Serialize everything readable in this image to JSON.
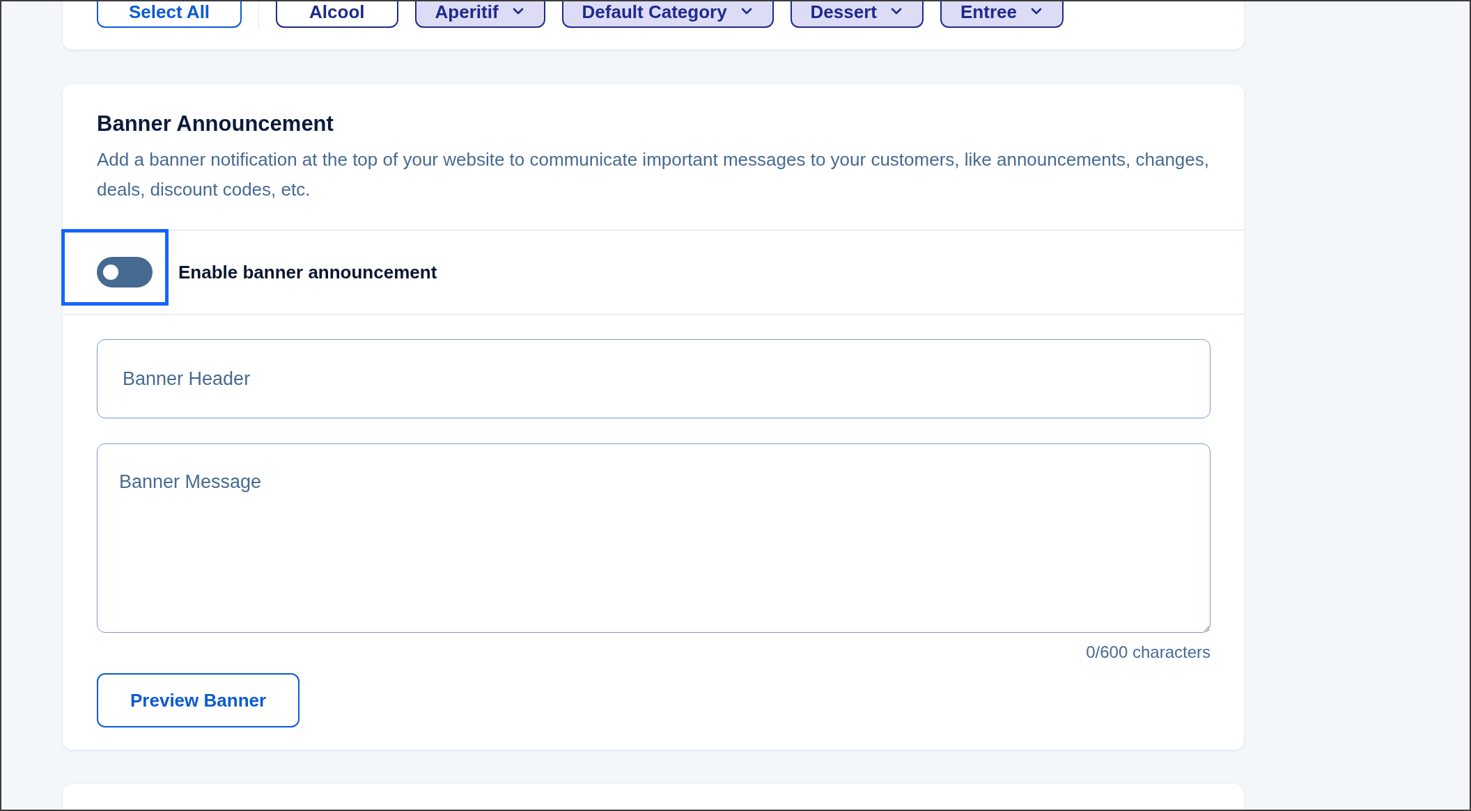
{
  "category_filter": {
    "select_all": "Select All",
    "categories": [
      {
        "label": "Alcool",
        "selected": false,
        "has_menu": false
      },
      {
        "label": "Aperitif",
        "selected": true,
        "has_menu": true
      },
      {
        "label": "Default Category",
        "selected": true,
        "has_menu": true
      },
      {
        "label": "Dessert",
        "selected": true,
        "has_menu": true
      },
      {
        "label": "Entree",
        "selected": true,
        "has_menu": true
      }
    ]
  },
  "banner": {
    "title": "Banner Announcement",
    "description": "Add a banner notification at the top of your website to communicate important messages to your customers, like announcements, changes, deals, discount codes, etc.",
    "toggle": {
      "label": "Enable banner announcement",
      "on": false,
      "focused": true
    },
    "header_field": {
      "placeholder": "Banner Header"
    },
    "message_field": {
      "placeholder": "Banner Message"
    },
    "char_count": "0/600 characters",
    "preview_button": "Preview Banner"
  }
}
